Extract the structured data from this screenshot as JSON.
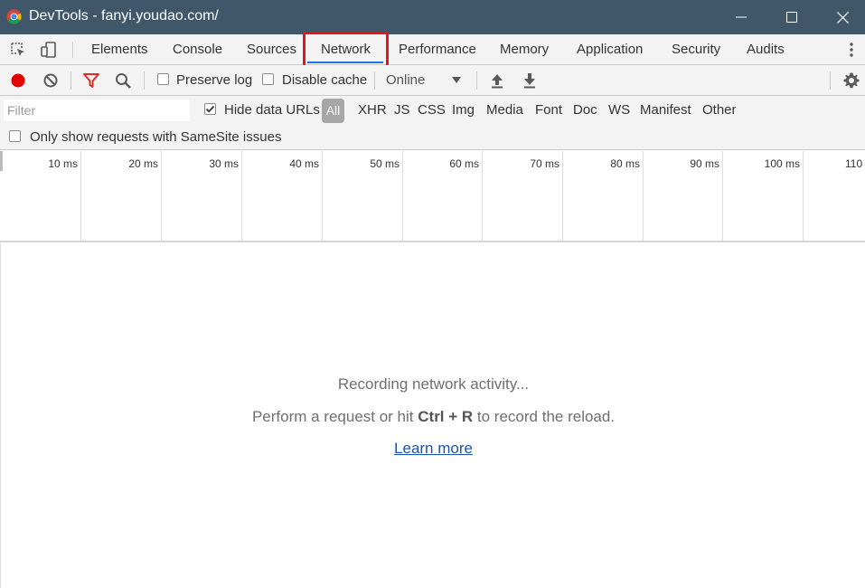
{
  "window": {
    "title": "DevTools - fanyi.youdao.com/"
  },
  "tabs": [
    {
      "label": "Elements"
    },
    {
      "label": "Console"
    },
    {
      "label": "Sources"
    },
    {
      "label": "Network",
      "active": true
    },
    {
      "label": "Performance"
    },
    {
      "label": "Memory"
    },
    {
      "label": "Application"
    },
    {
      "label": "Security"
    },
    {
      "label": "Audits"
    }
  ],
  "toolbar": {
    "preserve_log": {
      "label": "Preserve log",
      "checked": false
    },
    "disable_cache": {
      "label": "Disable cache",
      "checked": false
    },
    "throttling": {
      "selected": "Online"
    }
  },
  "filterbar": {
    "filter_placeholder": "Filter",
    "hide_data_urls": {
      "label": "Hide data URLs",
      "checked": true
    },
    "types": [
      "All",
      "XHR",
      "JS",
      "CSS",
      "Img",
      "Media",
      "Font",
      "Doc",
      "WS",
      "Manifest",
      "Other"
    ],
    "samesite": {
      "label": "Only show requests with SameSite issues",
      "checked": false
    }
  },
  "timeline": {
    "ticks": [
      "10 ms",
      "20 ms",
      "30 ms",
      "40 ms",
      "50 ms",
      "60 ms",
      "70 ms",
      "80 ms",
      "90 ms",
      "100 ms",
      "110"
    ]
  },
  "empty_state": {
    "line1": "Recording network activity...",
    "line2_prefix": "Perform a request or hit ",
    "line2_shortcut": "Ctrl + R",
    "line2_suffix": " to record the reload.",
    "learn_more": "Learn more"
  },
  "colors": {
    "titlebar": "#3f5768",
    "record_active": "#e50000",
    "filter_active": "#d93025",
    "highlight_box": "#e5141e",
    "link": "#1a55a8"
  }
}
